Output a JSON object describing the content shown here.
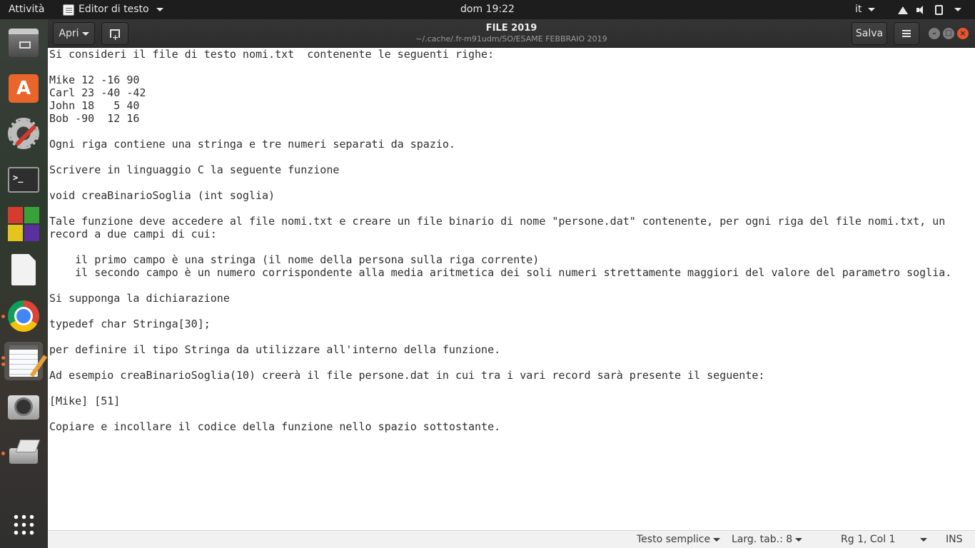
{
  "topbar": {
    "activities": "Attività",
    "app_name": "Editor di testo",
    "clock": "dom 19:22",
    "input_lang": "it"
  },
  "dock": {
    "items": [
      "files",
      "software",
      "settings",
      "terminal",
      "office",
      "document-viewer",
      "chrome",
      "text-editor",
      "camera",
      "scanner",
      "show-applications"
    ]
  },
  "window": {
    "title": "FILE 2019",
    "subtitle": "~/.cache/.fr-m91udm/SO/ESAME FEBBRAIO 2019",
    "open_label": "Apri",
    "save_label": "Salva"
  },
  "editor": {
    "lines": [
      "Si consideri il file di testo nomi.txt  contenente le seguenti righe:",
      "",
      "Mike 12 -16 90",
      "Carl 23 -40 -42",
      "John 18   5 40",
      "Bob -90  12 16",
      "",
      "Ogni riga contiene una stringa e tre numeri separati da spazio.",
      "",
      "Scrivere in linguaggio C la seguente funzione",
      "",
      "void creaBinarioSoglia (int soglia)",
      "",
      "Tale funzione deve accedere al file nomi.txt e creare un file binario di nome \"persone.dat\" contenente, per ogni riga del file nomi.txt, un",
      "record a due campi di cui:",
      "",
      "    il primo campo è una stringa (il nome della persona sulla riga corrente)",
      "    il secondo campo è un numero corrispondente alla media aritmetica dei soli numeri strettamente maggiori del valore del parametro soglia.",
      "",
      "Si supponga la dichiarazione",
      "",
      "typedef char Stringa[30];",
      "",
      "per definire il tipo Stringa da utilizzare all'interno della funzione.",
      "",
      "Ad esempio creaBinarioSoglia(10) creerà il file persone.dat in cui tra i vari record sarà presente il seguente:",
      "",
      "[Mike] [51]",
      "",
      "Copiare e incollare il codice della funzione nello spazio sottostante."
    ]
  },
  "statusbar": {
    "language": "Testo semplice",
    "tab_width": "Larg. tab.: 8",
    "position": "Rg 1, Col 1",
    "mode": "INS"
  },
  "colors": {
    "accent": "#e9542e",
    "topbar_bg": "#1d1d1d",
    "headerbar_bg": "#2d2d2d",
    "statusbar_bg": "#f1f1f1"
  }
}
